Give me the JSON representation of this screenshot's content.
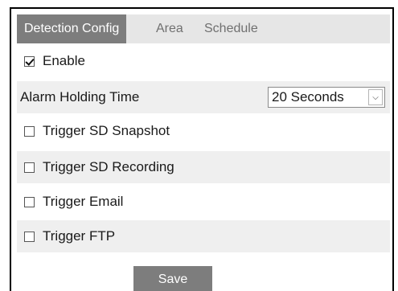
{
  "tabs": [
    {
      "label": "Detection Config",
      "active": true
    },
    {
      "label": "Area",
      "active": false
    },
    {
      "label": "Schedule",
      "active": false
    }
  ],
  "enable": {
    "label": "Enable",
    "checked": true
  },
  "alarm_holding_time": {
    "label": "Alarm Holding Time",
    "value": "20 Seconds"
  },
  "triggers": [
    {
      "label": "Trigger SD Snapshot",
      "checked": false
    },
    {
      "label": "Trigger SD Recording",
      "checked": false
    },
    {
      "label": "Trigger Email",
      "checked": false
    },
    {
      "label": "Trigger FTP",
      "checked": false
    }
  ],
  "save_label": "Save",
  "colors": {
    "tab_active": "#7d7d7d",
    "tabbar": "#e6e6e6",
    "row_shade": "#efefef",
    "button": "#7d7d7d"
  }
}
